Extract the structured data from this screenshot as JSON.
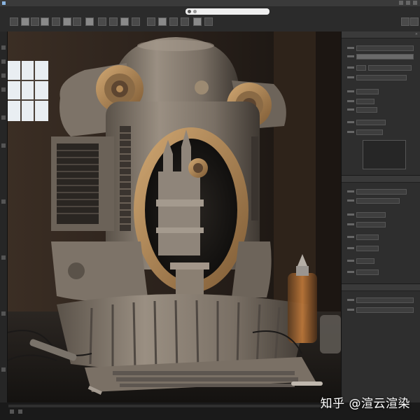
{
  "window": {
    "title": "",
    "address_text": ""
  },
  "right_panel": {
    "sections": [
      {
        "header": ""
      },
      {
        "header": ""
      },
      {
        "header": ""
      }
    ]
  },
  "watermark": {
    "text": "知乎 @渲云渲染"
  },
  "image": {
    "subject": "steampunk-machine-render",
    "palette": {
      "wall": "#2a211b",
      "machine_body": "#8c8277",
      "machine_shadow": "#4d4640",
      "bronze": "#b08a5a",
      "window_light": "#e9eef2"
    }
  }
}
